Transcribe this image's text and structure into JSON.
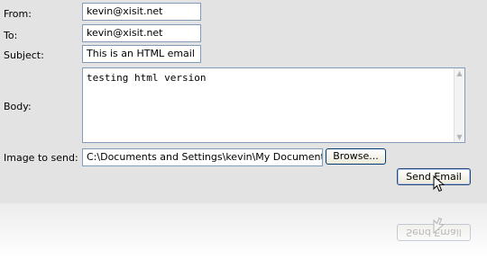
{
  "form": {
    "from_label": "From:",
    "from_value": "kevin@xisit.net",
    "to_label": "To:",
    "to_value": "kevin@xisit.net",
    "subject_label": "Subject:",
    "subject_value": "This is an HTML email",
    "body_label": "Body:",
    "body_value": "testing html version",
    "image_label": "Image to send:",
    "image_value": "C:\\Documents and Settings\\kevin\\My Documents\\My P",
    "browse_label": "Browse...",
    "send_label": "Send Email"
  }
}
